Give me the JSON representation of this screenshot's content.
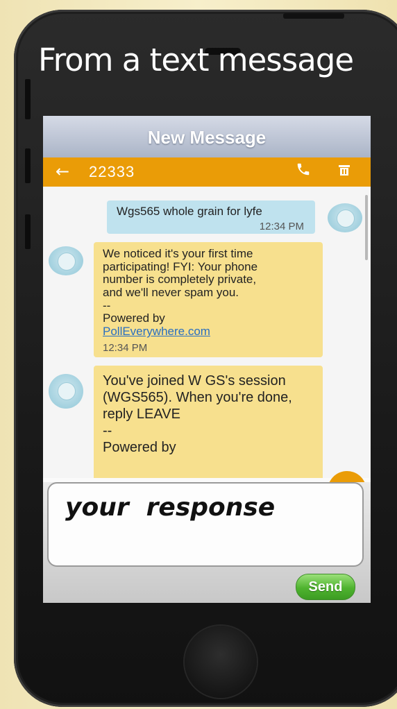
{
  "slide": {
    "headline": "From a text message"
  },
  "screen": {
    "header_title": "New Message",
    "appbar": {
      "back_icon": "arrow-left-icon",
      "contact_number": "22333",
      "call_icon": "phone-icon",
      "delete_icon": "trash-icon",
      "color": "#ea9c07"
    },
    "messages": [
      {
        "direction": "outgoing",
        "text": "Wgs565 whole grain for lyfe",
        "time": "12:34 PM"
      },
      {
        "direction": "incoming",
        "lines": [
          "We noticed it's your first time",
          "participating! FYI: Your phone",
          "number is completely private,",
          "and we'll never spam you.",
          "--",
          "Powered by"
        ],
        "link": "PollEverywhere.com",
        "time": "12:34 PM"
      },
      {
        "direction": "incoming",
        "lines": [
          "You've joined W GS's session",
          "(WGS565). When you're done,",
          "reply LEAVE",
          "--",
          "Powered by"
        ]
      }
    ],
    "compose": {
      "response_text": "your  response",
      "send_label": "Send"
    }
  }
}
